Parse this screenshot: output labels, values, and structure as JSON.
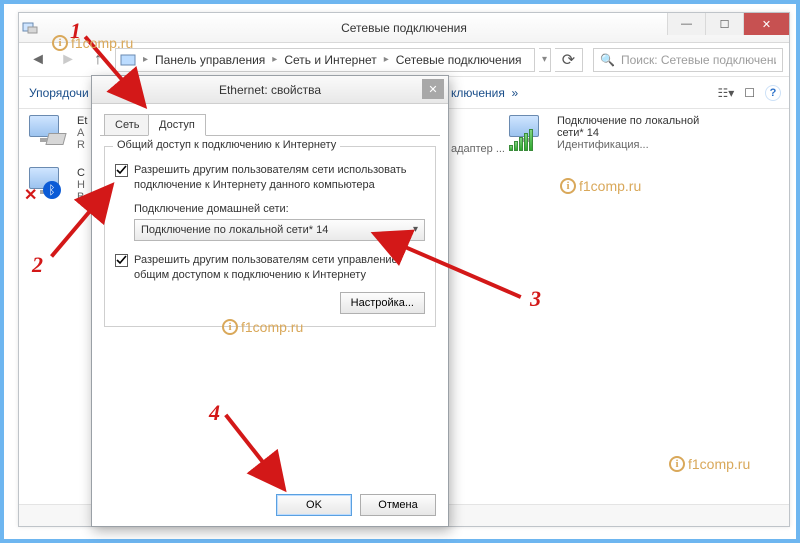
{
  "window": {
    "title": "Сетевые подключения",
    "breadcrumb": {
      "p1": "Панель управления",
      "p2": "Сеть и Интернет",
      "p3": "Сетевые подключения"
    },
    "search_placeholder": "Поиск: Сетевые подключения",
    "toolbar_fragment": "Упорядочи",
    "toolbar_tail": "ключения",
    "help_label": "?"
  },
  "connections": {
    "item1": {
      "name": "Et",
      "l2": "A",
      "l3": "R",
      "adapter_tail": "адаптер ..."
    },
    "item2": {
      "name": "С",
      "l2": "Н",
      "l3": "B"
    },
    "item3": {
      "name": "Подключение по локальной",
      "name2": "сети* 14",
      "status": "Идентификация..."
    }
  },
  "dialog": {
    "title": "Ethernet: свойства",
    "tab_network": "Сеть",
    "tab_sharing": "Доступ",
    "group_title": "Общий доступ к подключению к Интернету",
    "chk1": "Разрешить другим пользователям сети использовать подключение к Интернету данного компьютера",
    "combo_label": "Подключение домашней сети:",
    "combo_value": "Подключение по локальной сети* 14",
    "chk2": "Разрешить другим пользователям сети управление общим доступом к подключению к Интернету",
    "settings_btn": "Настройка...",
    "ok": "OK",
    "cancel": "Отмена"
  },
  "annotations": {
    "n1": "1",
    "n2": "2",
    "n3": "3",
    "n4": "4",
    "watermark": "f1comp.ru"
  }
}
